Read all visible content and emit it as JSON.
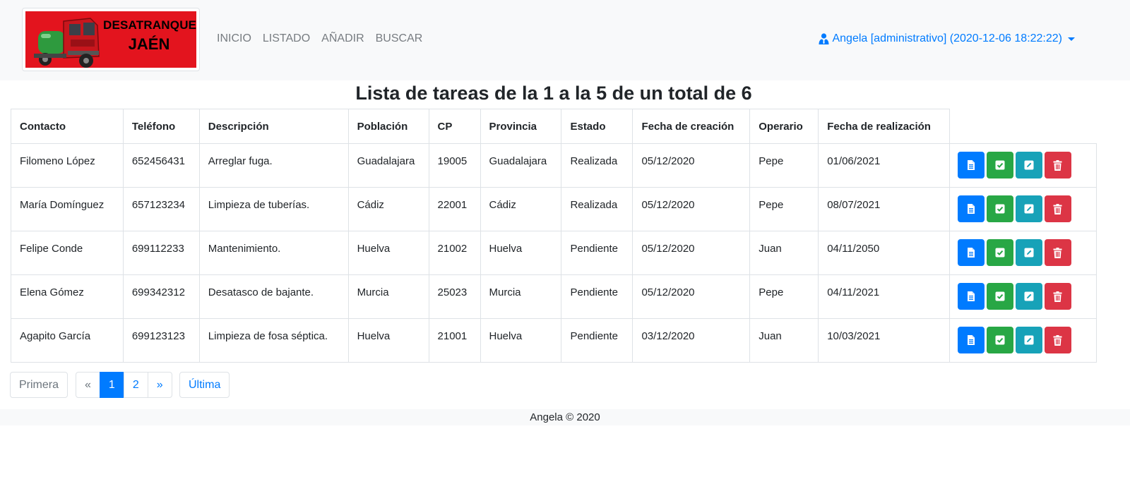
{
  "brand": {
    "line1": "DESATRANQUES",
    "line2": "JAÉN",
    "colors": {
      "background": "#e3141e",
      "truck": "#c8161d",
      "tank": "#2e9a3e"
    }
  },
  "nav": {
    "items": [
      "INICIO",
      "LISTADO",
      "AÑADIR",
      "BUSCAR"
    ]
  },
  "user": {
    "icon": "user-tie-icon",
    "label": "Angela [administrativo] (2020-12-06 18:22:22)"
  },
  "page": {
    "title": "Lista de tareas de la 1 a la 5 de un total de 6"
  },
  "table": {
    "headers": [
      "Contacto",
      "Teléfono",
      "Descripción",
      "Población",
      "CP",
      "Provincia",
      "Estado",
      "Fecha de creación",
      "Operario",
      "Fecha de realización"
    ],
    "rows": [
      [
        "Filomeno López",
        "652456431",
        "Arreglar fuga.",
        "Guadalajara",
        "19005",
        "Guadalajara",
        "Realizada",
        "05/12/2020",
        "Pepe",
        "01/06/2021"
      ],
      [
        "María Domínguez",
        "657123234",
        "Limpieza de tuberías.",
        "Cádiz",
        "22001",
        "Cádiz",
        "Realizada",
        "05/12/2020",
        "Pepe",
        "08/07/2021"
      ],
      [
        "Felipe Conde",
        "699112233",
        "Mantenimiento.",
        "Huelva",
        "21002",
        "Huelva",
        "Pendiente",
        "05/12/2020",
        "Juan",
        "04/11/2050"
      ],
      [
        "Elena Gómez",
        "699342312",
        "Desatasco de bajante.",
        "Murcia",
        "25023",
        "Murcia",
        "Pendiente",
        "05/12/2020",
        "Pepe",
        "04/11/2021"
      ],
      [
        "Agapito García",
        "699123123",
        "Limpieza de fosa séptica.",
        "Huelva",
        "21001",
        "Huelva",
        "Pendiente",
        "03/12/2020",
        "Juan",
        "10/03/2021"
      ]
    ],
    "row_actions": [
      {
        "icon": "file-icon",
        "color": "#007bff"
      },
      {
        "icon": "check-square-icon",
        "color": "#28a745"
      },
      {
        "icon": "edit-icon",
        "color": "#17a2b8"
      },
      {
        "icon": "trash-icon",
        "color": "#dc3545"
      }
    ]
  },
  "pagination": {
    "first": "Primera",
    "prev": "«",
    "pages": [
      "1",
      "2"
    ],
    "current": "1",
    "next": "»",
    "last": "Última"
  },
  "footer": {
    "text": "Angela © 2020"
  }
}
